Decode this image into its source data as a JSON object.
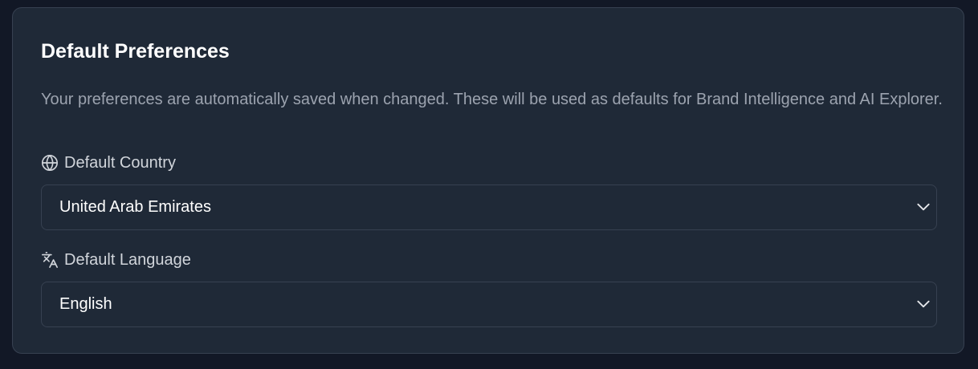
{
  "preferences": {
    "title": "Default Preferences",
    "description": "Your preferences are automatically saved when changed. These will be used as defaults for Brand Intelligence and AI Explorer.",
    "country": {
      "label": "Default Country",
      "icon": "globe-icon",
      "value": "United Arab Emirates"
    },
    "language": {
      "label": "Default Language",
      "icon": "translate-icon",
      "value": "English"
    }
  },
  "colors": {
    "background": "#121826",
    "card": "#1f2937",
    "border": "#374151",
    "text": "#ffffff",
    "muted": "#9ca3af"
  }
}
